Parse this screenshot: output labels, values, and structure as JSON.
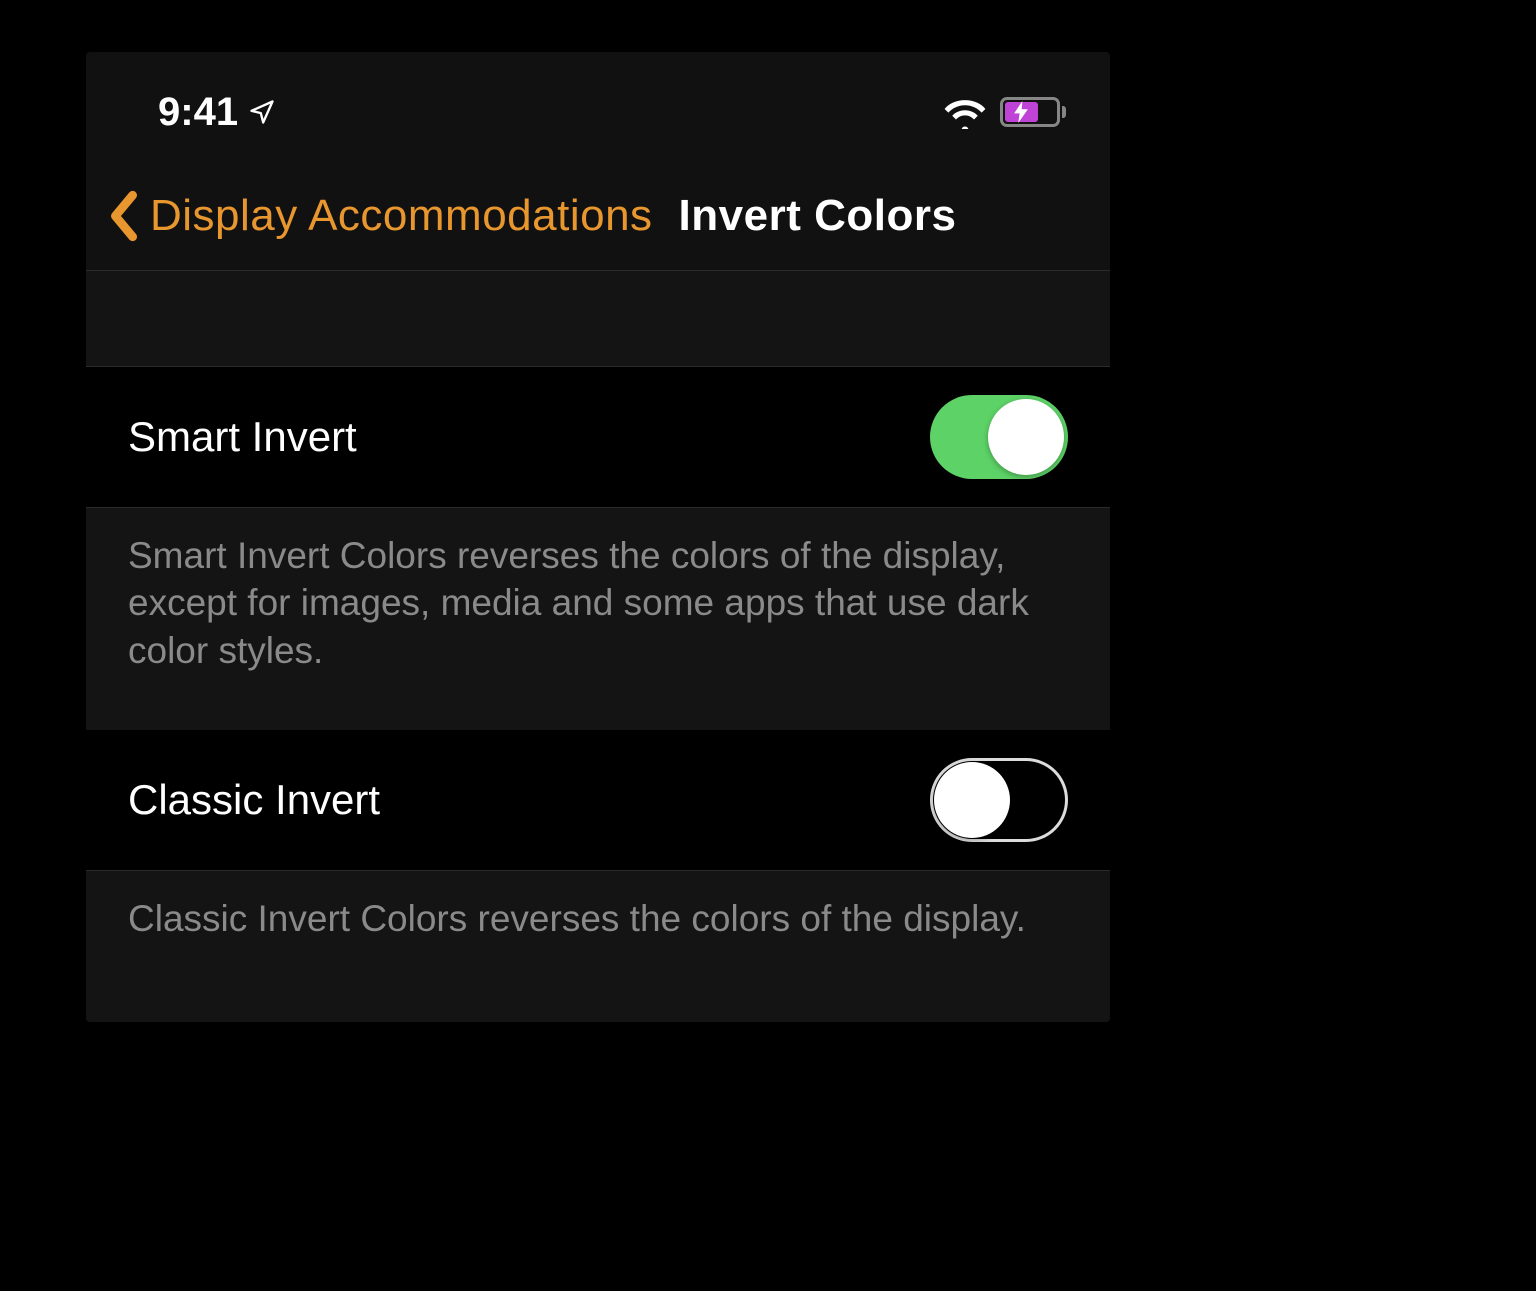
{
  "status_bar": {
    "time": "9:41",
    "location_icon": "location-arrow-icon",
    "wifi_icon": "wifi-icon",
    "battery_icon": "battery-charging-icon"
  },
  "nav": {
    "back_label": "Display Accommodations",
    "title": "Invert Colors"
  },
  "settings": [
    {
      "label": "Smart Invert",
      "enabled": true,
      "description": "Smart Invert Colors reverses the colors of the display, except for images, media and some apps that use dark color styles."
    },
    {
      "label": "Classic Invert",
      "enabled": false,
      "description": "Classic Invert Colors reverses the colors of the display."
    }
  ],
  "colors": {
    "accent": "#e8962e",
    "toggle_on": "#5dd267",
    "battery_fill": "#c043d8"
  }
}
